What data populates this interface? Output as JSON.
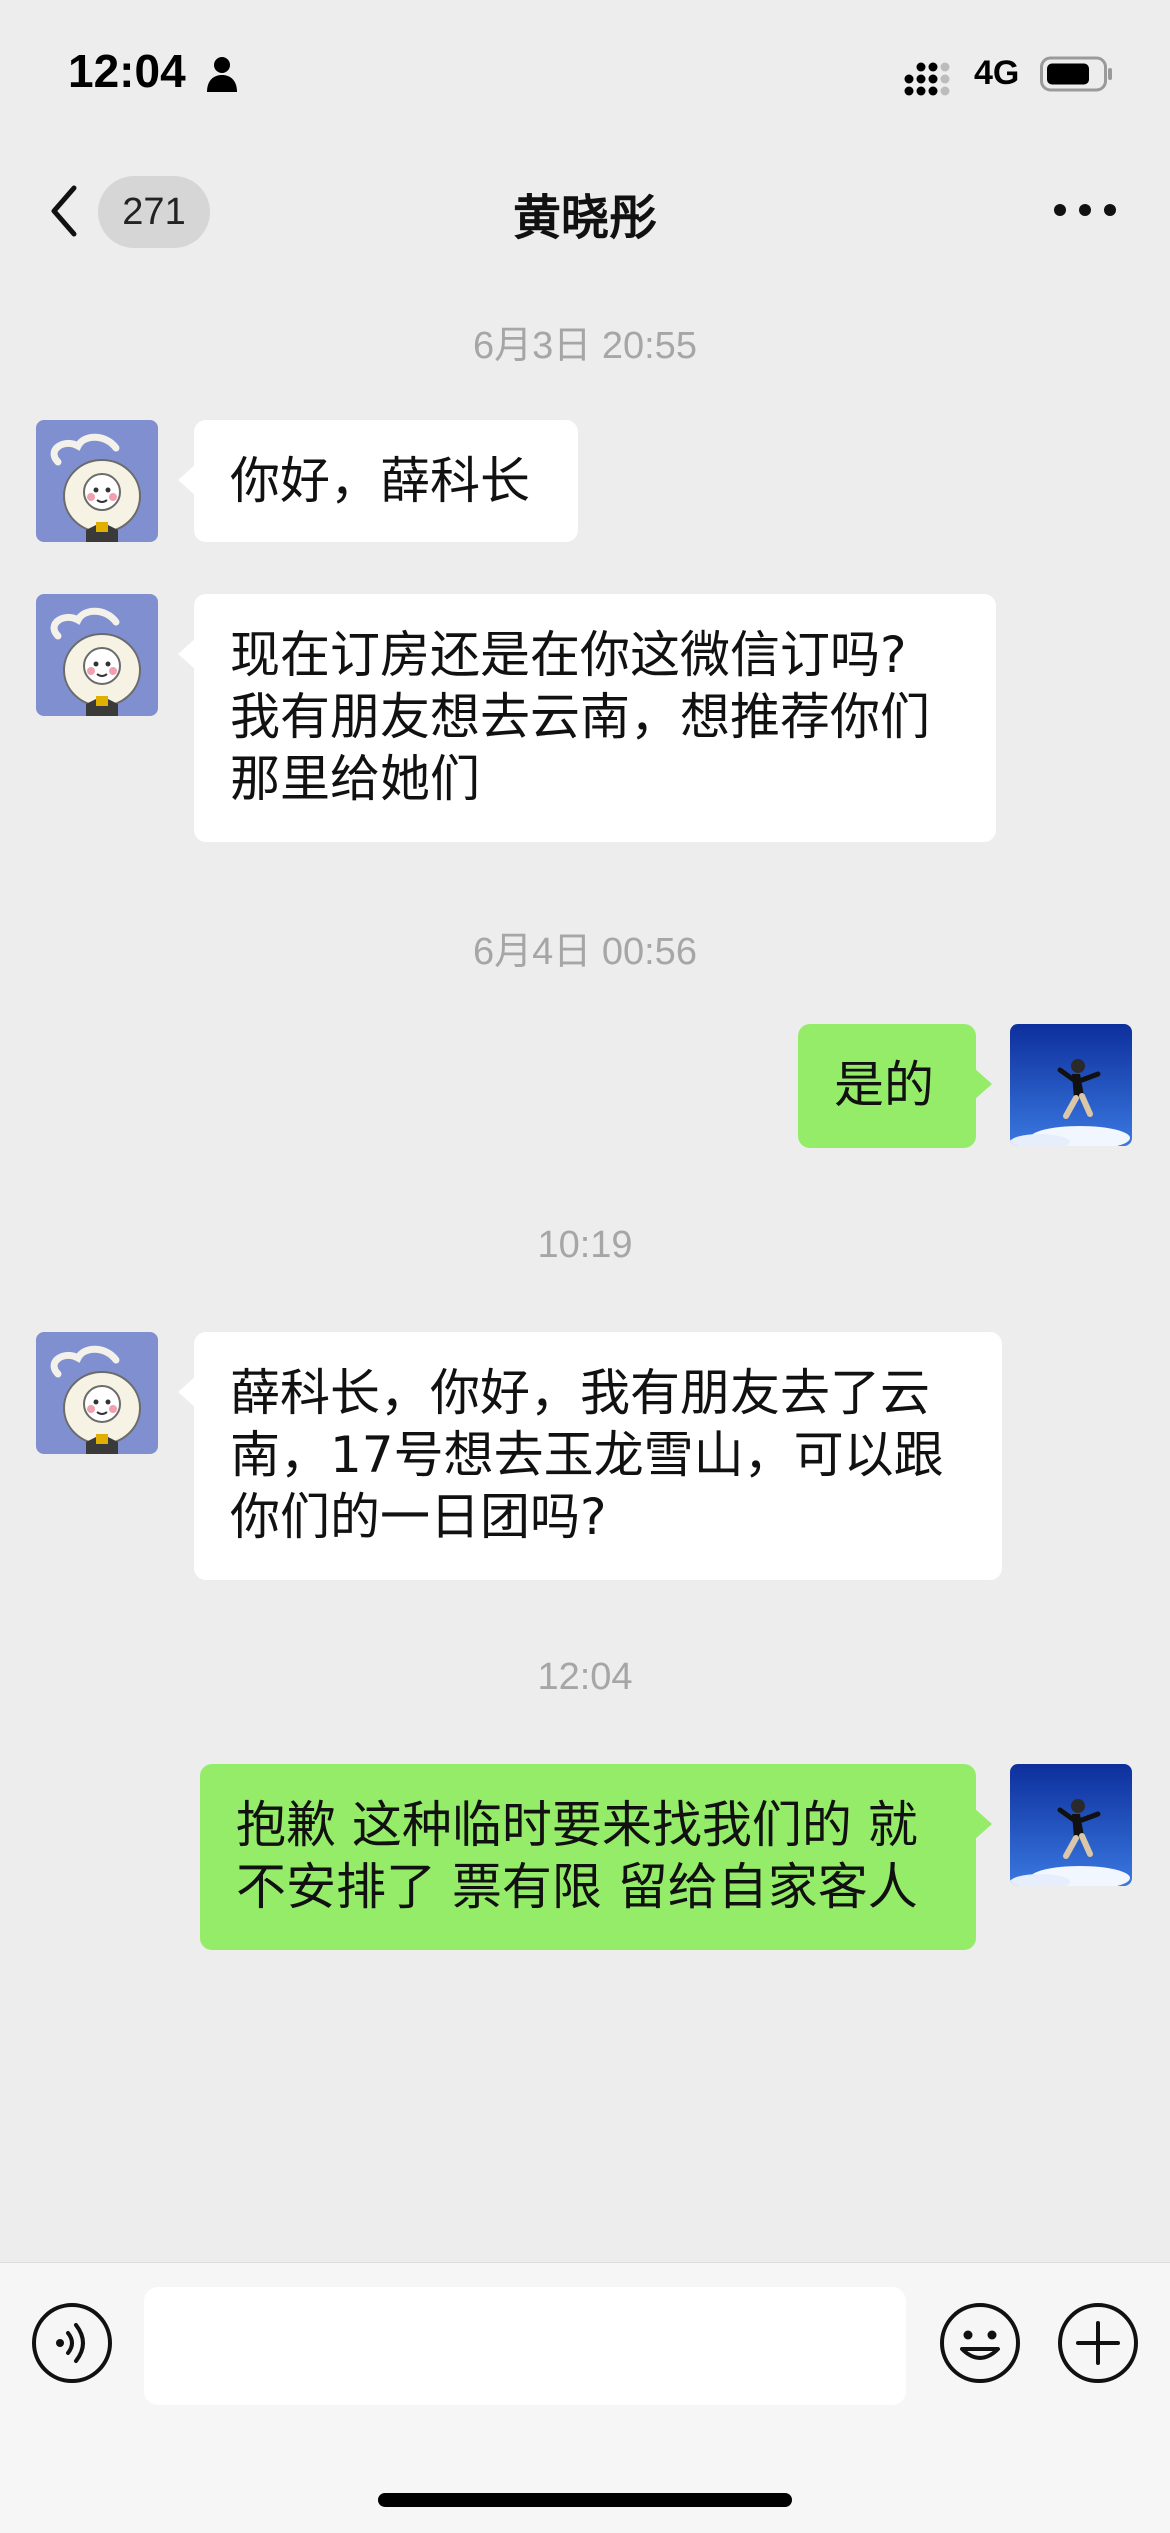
{
  "status_bar": {
    "time": "12:04",
    "network": "4G"
  },
  "nav": {
    "unread_count": "271",
    "title": "黄晓彤"
  },
  "messages": [
    {
      "type": "timestamp",
      "text": "6月3日 20:55"
    },
    {
      "type": "incoming",
      "lines": [
        "你好，薛科长"
      ]
    },
    {
      "type": "incoming",
      "lines": [
        "现在订房还是在你这微信订吗?",
        "我有朋友想去云南，想推荐你们",
        "那里给她们"
      ]
    },
    {
      "type": "timestamp",
      "text": "6月4日 00:56"
    },
    {
      "type": "outgoing",
      "lines": [
        "是的"
      ]
    },
    {
      "type": "timestamp",
      "text": "10:19"
    },
    {
      "type": "incoming",
      "lines": [
        "薛科长，你好，我有朋友去了云",
        "南，17号想去玉龙雪山，可以跟",
        "你们的一日团吗?"
      ]
    },
    {
      "type": "timestamp",
      "text": "12:04"
    },
    {
      "type": "outgoing",
      "lines": [
        "抱歉 这种临时要来找我们的 就",
        "不安排了 票有限 留给自家客人"
      ]
    }
  ],
  "input": {
    "placeholder": ""
  },
  "icons": {
    "status_person": "person-icon",
    "status_signal": "signal-icon",
    "status_battery": "battery-icon",
    "back": "chevron-left-icon",
    "more": "more-dots-icon",
    "voice": "voice-icon",
    "emoji": "emoji-icon",
    "plus": "plus-icon"
  },
  "colors": {
    "background": "#ededed",
    "incoming_bubble": "#ffffff",
    "outgoing_bubble": "#95ec69",
    "timestamp_text": "#a6a6a6",
    "contact_avatar_bg": "#7f8fd0",
    "self_avatar_sky": "#1f4fc4"
  }
}
